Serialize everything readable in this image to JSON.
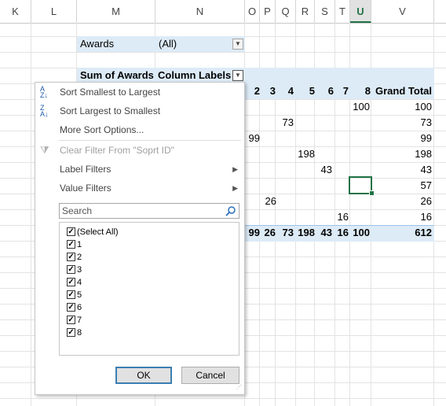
{
  "columns": [
    "K",
    "L",
    "M",
    "N",
    "O",
    "P",
    "Q",
    "R",
    "S",
    "T",
    "U",
    "V"
  ],
  "pivot": {
    "filter_label": "Awards",
    "filter_value": "(All)",
    "sum_label": "Sum of Awards",
    "col_labels": "Column Labels",
    "col_headers": [
      "2",
      "3",
      "4",
      "5",
      "6",
      "7",
      "8"
    ],
    "grand_total_label": "Grand Total",
    "rows": [
      {
        "U": "100",
        "V": "100"
      },
      {
        "Q": "73",
        "V": "73"
      },
      {
        "O": "99",
        "V": "99"
      },
      {
        "R": "198",
        "V": "198"
      },
      {
        "S": "43",
        "V": "43"
      },
      {
        "V": "57"
      },
      {
        "P": "26",
        "V": "26"
      },
      {
        "T": "16",
        "V": "16"
      }
    ],
    "totals": [
      "99",
      "26",
      "73",
      "198",
      "43",
      "16",
      "100",
      "612"
    ]
  },
  "menu": {
    "sort_asc": "Sort Smallest to Largest",
    "sort_desc": "Sort Largest to Smallest",
    "more_sort": "More Sort Options...",
    "clear_filter": "Clear Filter From \"Soprt ID\"",
    "label_filters": "Label Filters",
    "value_filters": "Value Filters",
    "search_placeholder": "Search",
    "items": [
      "(Select All)",
      "1",
      "2",
      "3",
      "4",
      "5",
      "6",
      "7",
      "8"
    ],
    "ok": "OK",
    "cancel": "Cancel"
  }
}
